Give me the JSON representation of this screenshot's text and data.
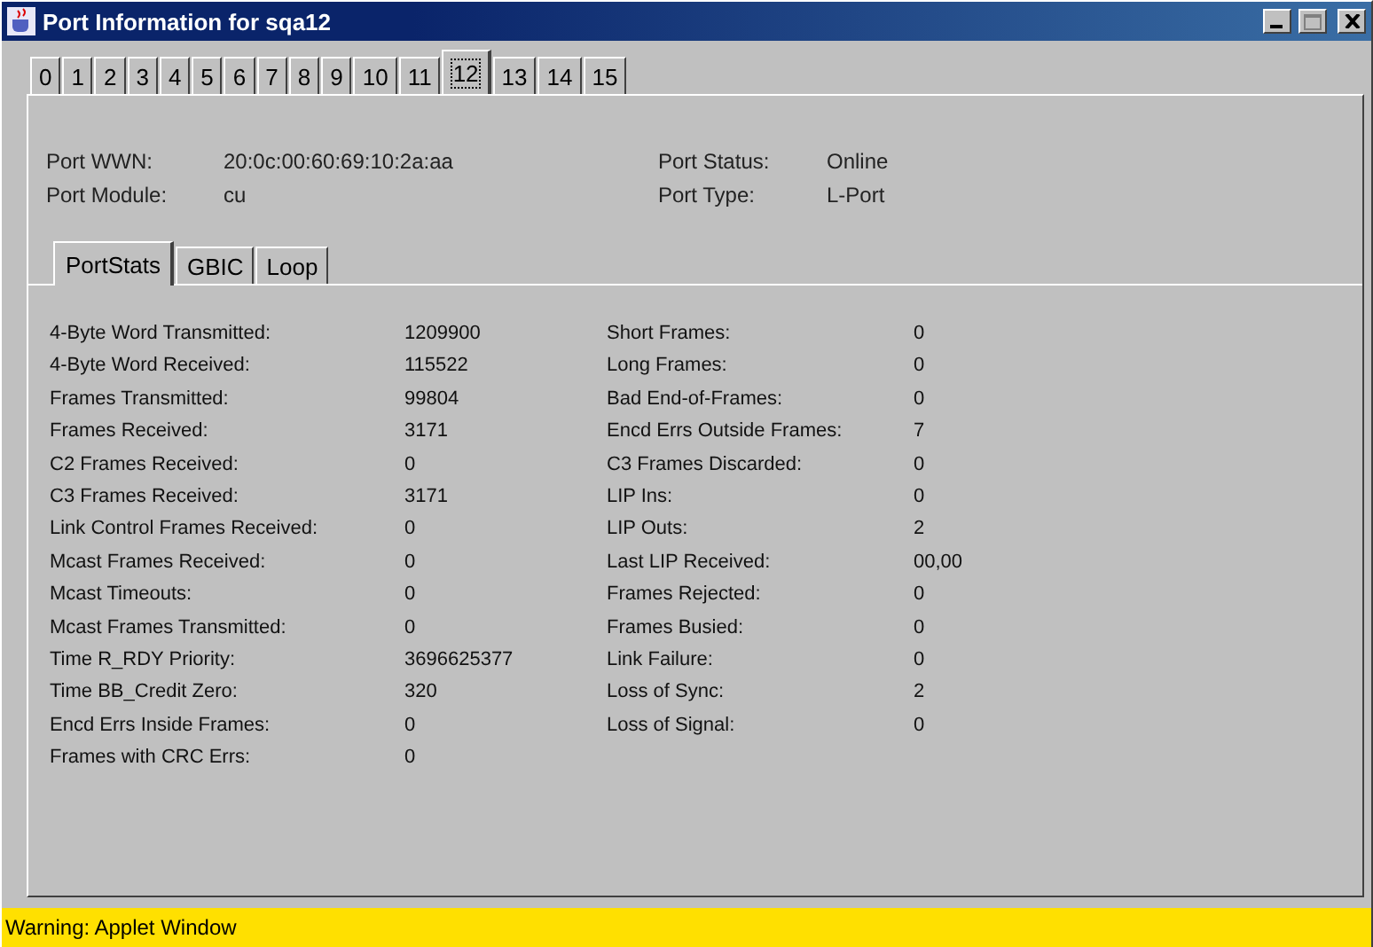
{
  "window": {
    "title": "Port Information for sqa12"
  },
  "port_tabs": [
    {
      "label": "0",
      "selected": false
    },
    {
      "label": "1",
      "selected": false
    },
    {
      "label": "2",
      "selected": false
    },
    {
      "label": "3",
      "selected": false
    },
    {
      "label": "4",
      "selected": false
    },
    {
      "label": "5",
      "selected": false
    },
    {
      "label": "6",
      "selected": false
    },
    {
      "label": "7",
      "selected": false
    },
    {
      "label": "8",
      "selected": false
    },
    {
      "label": "9",
      "selected": false
    },
    {
      "label": "10",
      "selected": false
    },
    {
      "label": "11",
      "selected": false
    },
    {
      "label": "12",
      "selected": true
    },
    {
      "label": "13",
      "selected": false
    },
    {
      "label": "14",
      "selected": false
    },
    {
      "label": "15",
      "selected": false
    }
  ],
  "port_info": {
    "left": [
      {
        "label": "Port WWN:",
        "value": "20:0c:00:60:69:10:2a:aa"
      },
      {
        "label": "Port Module:",
        "value": "cu"
      }
    ],
    "right": [
      {
        "label": "Port Status:",
        "value": "Online"
      },
      {
        "label": "Port Type:",
        "value": "L-Port"
      }
    ]
  },
  "detail_tabs": [
    {
      "label": "PortStats",
      "selected": true
    },
    {
      "label": "GBIC",
      "selected": false
    },
    {
      "label": "Loop",
      "selected": false
    }
  ],
  "stats_left": [
    {
      "label": "4-Byte Word Transmitted:",
      "value": "1209900"
    },
    {
      "label": "4-Byte Word Received:",
      "value": "115522"
    },
    {
      "label": "Frames Transmitted:",
      "value": "99804"
    },
    {
      "label": "Frames Received:",
      "value": "3171"
    },
    {
      "label": "C2 Frames Received:",
      "value": "0"
    },
    {
      "label": "C3 Frames Received:",
      "value": "3171"
    },
    {
      "label": "Link Control Frames Received:",
      "value": "0"
    },
    {
      "label": "Mcast Frames Received:",
      "value": "0"
    },
    {
      "label": "Mcast Timeouts:",
      "value": "0"
    },
    {
      "label": "Mcast Frames Transmitted:",
      "value": "0"
    },
    {
      "label": "Time R_RDY Priority:",
      "value": "3696625377"
    },
    {
      "label": "Time BB_Credit Zero:",
      "value": "320"
    },
    {
      "label": "Encd Errs Inside Frames:",
      "value": "0"
    },
    {
      "label": "Frames with CRC Errs:",
      "value": "0"
    }
  ],
  "stats_right": [
    {
      "label": "Short Frames:",
      "value": "0"
    },
    {
      "label": "Long Frames:",
      "value": "0"
    },
    {
      "label": "Bad End-of-Frames:",
      "value": "0"
    },
    {
      "label": "Encd Errs Outside Frames:",
      "value": "7"
    },
    {
      "label": "C3 Frames Discarded:",
      "value": "0"
    },
    {
      "label": "LIP Ins:",
      "value": "0"
    },
    {
      "label": "LIP Outs:",
      "value": "2"
    },
    {
      "label": "Last LIP Received:",
      "value": "00,00"
    },
    {
      "label": "Frames Rejected:",
      "value": "0"
    },
    {
      "label": "Frames Busied:",
      "value": "0"
    },
    {
      "label": "Link Failure:",
      "value": "0"
    },
    {
      "label": "Loss of Sync:",
      "value": "2"
    },
    {
      "label": "Loss of Signal:",
      "value": "0"
    }
  ],
  "status_bar": {
    "text": "Warning: Applet Window"
  }
}
